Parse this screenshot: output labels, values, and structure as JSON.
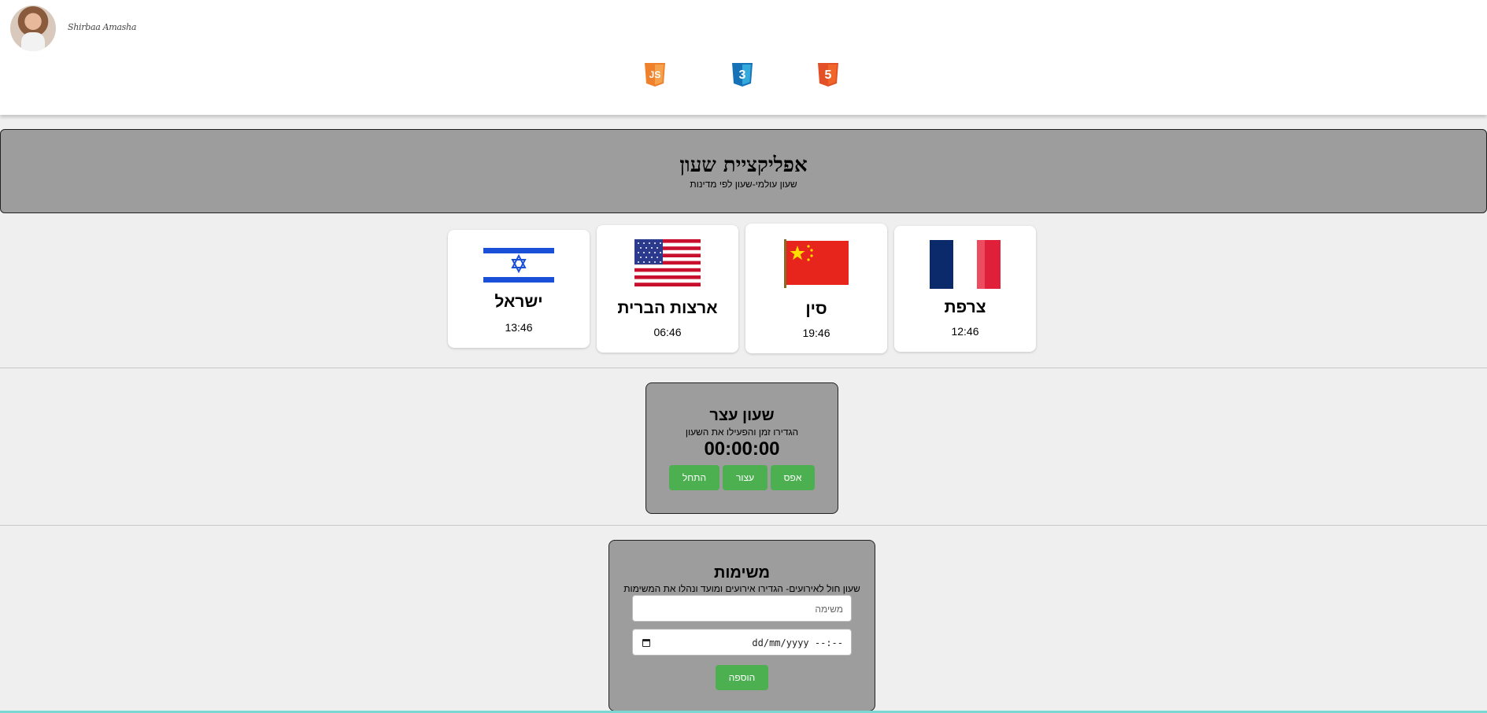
{
  "header": {
    "author_name": "Shirbaa Amasha",
    "tech_icons": [
      "javascript-icon",
      "css3-icon",
      "html5-icon"
    ],
    "tech_labels": [
      "JS",
      "3",
      "5"
    ]
  },
  "banner": {
    "title": "אפליקציית שעון",
    "subtitle": "שעון עולמי-שעון לפי מדינות"
  },
  "countries": [
    {
      "name": "ישראל",
      "time": "13:46"
    },
    {
      "name": "ארצות הברית",
      "time": "06:46"
    },
    {
      "name": "סין",
      "time": "19:46"
    },
    {
      "name": "צרפת",
      "time": "12:46"
    }
  ],
  "stopwatch": {
    "title": "שעון עצר",
    "subtitle": "הגדירו זמן והפעילו את השעון",
    "display": "00:00:00",
    "start_label": "התחל",
    "stop_label": "עצור",
    "reset_label": "אפס"
  },
  "tasks": {
    "title": "משימות",
    "subtitle": "שעון חול לאירועים- הגדירו אירועים ומועד ונהלו את המשימות",
    "task_placeholder": "משימה",
    "datetime_placeholder": "dd/mm/yyyy  --:--",
    "add_label": "הוספה"
  },
  "colors": {
    "accent_green": "#4caf50",
    "panel_gray": "#9c9d9c",
    "page_bg": "#efefef"
  }
}
